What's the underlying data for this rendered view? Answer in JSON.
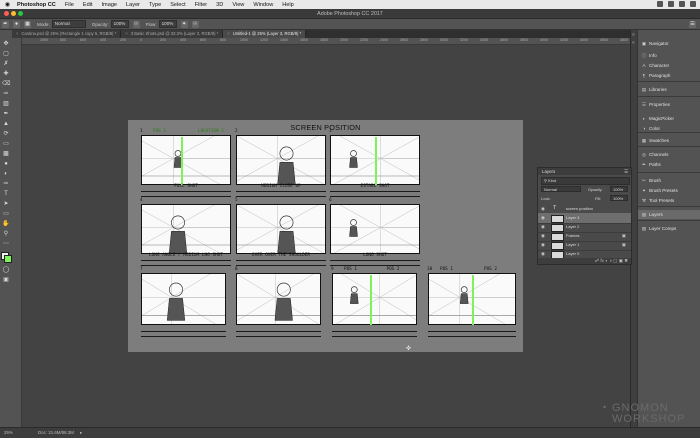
{
  "menubar": {
    "app": "Photoshop CC",
    "items": [
      "File",
      "Edit",
      "Image",
      "Layer",
      "Type",
      "Select",
      "Filter",
      "3D",
      "View",
      "Window",
      "Help"
    ]
  },
  "window": {
    "title": "Adobe Photoshop CC 2017"
  },
  "options_bar": {
    "mode_label": "Mode:",
    "mode_value": "Normal",
    "opacity_label": "Opacity:",
    "opacity_value": "100%",
    "flow_label": "Flow:",
    "flow_value": "100%"
  },
  "tabs": [
    {
      "label": "Cantina.psd @ 25% (Rectangle 1 copy 5, RGB/8) *",
      "active": false
    },
    {
      "label": "3 Basic Shots.psd @ 33.3% (Layer 2, RGB/8) *",
      "active": false
    },
    {
      "label": "Untitled-1 @ 25% (Layer 3, RGB/8) *",
      "active": true
    }
  ],
  "ruler_marks": [
    "1000",
    "800",
    "600",
    "400",
    "200",
    "0",
    "200",
    "400",
    "600",
    "800",
    "1000",
    "1200",
    "1400",
    "1600",
    "1800",
    "2000",
    "2200",
    "2400",
    "2600",
    "2800",
    "3000",
    "3200",
    "3400",
    "3600",
    "3800",
    "4000",
    "4200",
    "4400",
    "4600",
    "4800",
    "5000"
  ],
  "canvas": {
    "title": "SCREEN POSITION",
    "panels": [
      {
        "num": "1",
        "caption": "FULL SHOT",
        "tags": [
          "POS 1",
          "LOCATION 2"
        ]
      },
      {
        "num": "2",
        "caption": "MEDIUM CLOSE UP",
        "tags": []
      },
      {
        "num": "3",
        "caption": "ESTABL SHOT",
        "tags": []
      },
      {
        "num": "4",
        "caption": "LONG ANGLE / MEDIUM LNG SHOT",
        "tags": []
      },
      {
        "num": "5",
        "caption": "OVER OVER THE SHOULDER",
        "tags": []
      },
      {
        "num": "6",
        "caption": "LONG SHOT",
        "tags": []
      },
      {
        "num": "7",
        "caption": "",
        "tags": []
      },
      {
        "num": "8",
        "caption": "",
        "tags": []
      },
      {
        "num": "9",
        "caption": "",
        "tags": [
          "POS 1",
          "POS 2"
        ]
      },
      {
        "num": "10",
        "caption": "",
        "tags": [
          "POS 1",
          "POS 2"
        ]
      }
    ],
    "accent_color": "#7ef25a"
  },
  "dock": {
    "items": [
      {
        "label": "Navigator",
        "icon": "navigator-icon"
      },
      {
        "label": "Info",
        "icon": "info-icon"
      },
      {
        "label": "Character",
        "icon": "character-icon"
      },
      {
        "label": "Paragraph",
        "icon": "paragraph-icon"
      },
      {
        "label": "Libraries",
        "icon": "libraries-icon"
      },
      {
        "label": "Properties",
        "icon": "properties-icon"
      },
      {
        "label": "MagicPicker",
        "icon": "magicpicker-icon"
      },
      {
        "label": "Color",
        "icon": "color-icon"
      },
      {
        "label": "Swatches",
        "icon": "swatches-icon"
      },
      {
        "label": "Channels",
        "icon": "channels-icon"
      },
      {
        "label": "Paths",
        "icon": "paths-icon"
      },
      {
        "label": "Brush",
        "icon": "brush-icon"
      },
      {
        "label": "Brush Presets",
        "icon": "brush-presets-icon"
      },
      {
        "label": "Tool Presets",
        "icon": "tool-presets-icon"
      },
      {
        "label": "Layers",
        "icon": "layers-icon"
      },
      {
        "label": "Layer Comps",
        "icon": "layer-comps-icon"
      }
    ]
  },
  "layers_panel": {
    "title": "Layers",
    "filter_label": "Kind",
    "blend_mode": "Normal",
    "opacity_label": "Opacity:",
    "opacity_value": "100%",
    "lock_label": "Lock:",
    "fill_label": "Fill:",
    "fill_value": "100%",
    "layers": [
      {
        "name": "screen position",
        "type": "text",
        "selected": false,
        "locked": false
      },
      {
        "name": "Layer 3",
        "type": "pixel",
        "selected": true,
        "locked": false
      },
      {
        "name": "Layer 2",
        "type": "pixel",
        "selected": false,
        "locked": false
      },
      {
        "name": "Frames",
        "type": "pixel",
        "selected": false,
        "locked": true
      },
      {
        "name": "Layer 1",
        "type": "pixel",
        "selected": false,
        "locked": true
      },
      {
        "name": "Layer 0",
        "type": "pixel",
        "selected": false,
        "locked": false
      }
    ]
  },
  "status": {
    "zoom": "25%",
    "doc": "Doc: 31.6M/88.3M"
  },
  "watermark": {
    "line1": "GNOMON",
    "line2": "WORKSHOP"
  }
}
